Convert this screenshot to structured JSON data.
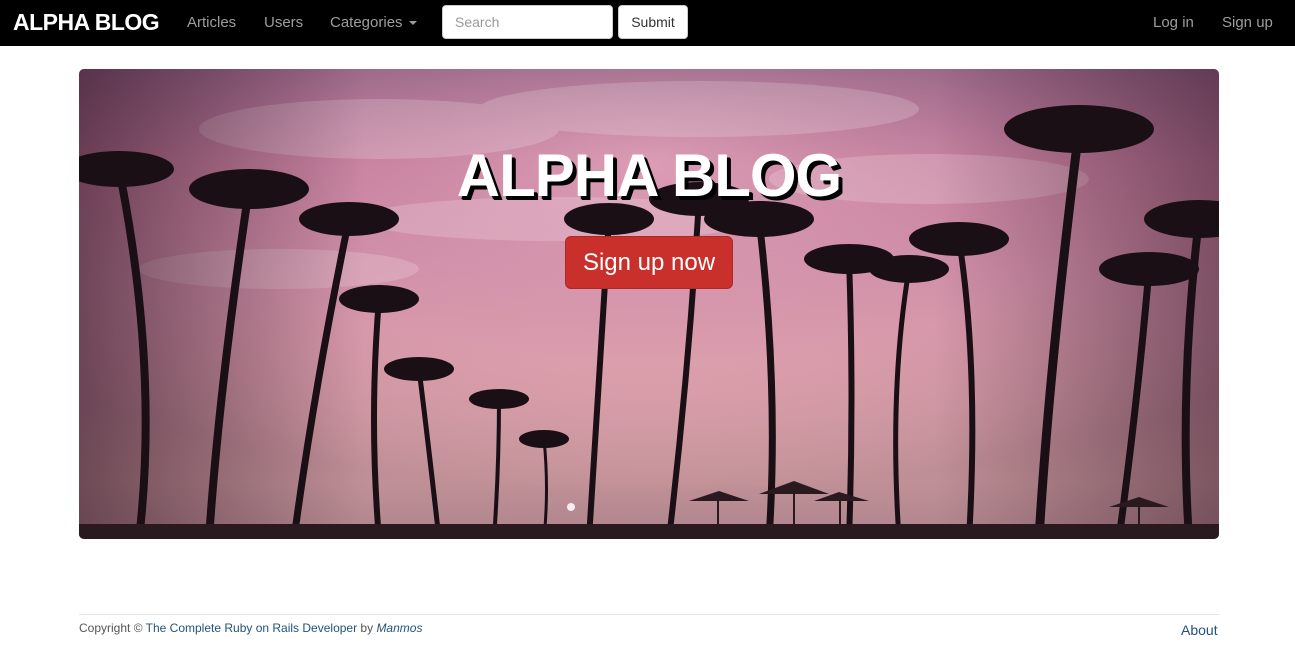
{
  "navbar": {
    "brand": "ALPHA BLOG",
    "links": {
      "articles": "Articles",
      "users": "Users",
      "categories": "Categories"
    },
    "search": {
      "placeholder": "Search",
      "value": ""
    },
    "submit_label": "Submit",
    "right": {
      "login": "Log in",
      "signup": "Sign up"
    }
  },
  "hero": {
    "title": "ALPHA BLOG",
    "cta_label": "Sign up now"
  },
  "footer": {
    "copyright_prefix": "Copyright © ",
    "course_link": "The Complete Ruby on Rails Developer",
    "by_text": " by ",
    "author": "Manmos",
    "about": "About"
  },
  "colors": {
    "navbar_bg": "#000000",
    "cta_bg": "#c9302c",
    "link": "#23527c"
  }
}
